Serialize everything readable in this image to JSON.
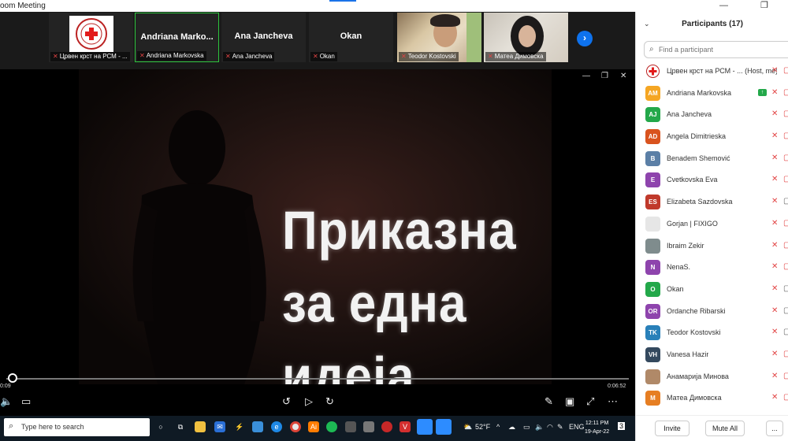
{
  "window": {
    "title": "oom Meeting",
    "restore_icon": "restore-icon"
  },
  "strip": {
    "tiles": [
      {
        "caption": "Црвен крст на РСМ - ...",
        "kind": "logo"
      },
      {
        "caption": "Andriana Markovska",
        "big_name": "Andriana Marko...",
        "active": true
      },
      {
        "caption": "Ana Jancheva",
        "big_name": "Ana Jancheva"
      },
      {
        "caption": "Okan",
        "big_name": "Okan"
      },
      {
        "caption": "Teodor Kostovski",
        "kind": "camera"
      },
      {
        "caption": "Матеа Димовска",
        "kind": "camera"
      }
    ],
    "next_icon": "chevron-right-icon"
  },
  "video": {
    "title_lines": [
      "Приказна",
      "за една",
      "идеја"
    ],
    "elapsed": "0:09",
    "duration": "0:06:52",
    "progress_fraction": 0.0022
  },
  "taskbar": {
    "search_placeholder": "Type here to search",
    "weather": "52°F",
    "language": "ENG",
    "time": "12:11 PM",
    "date": "19-Apr-22",
    "notification_count": "3"
  },
  "participants": {
    "title": "Participants (17)",
    "search_placeholder": "Find a participant",
    "list": [
      {
        "name": "Црвен крст на РСМ - ... (Host, me)",
        "initials": "",
        "color": "#ffffff",
        "cam": "red"
      },
      {
        "name": "Andriana Markovska",
        "initials": "AM",
        "color": "#f5a623",
        "cam": "red",
        "sharing": true
      },
      {
        "name": "Ana Jancheva",
        "initials": "AJ",
        "color": "#23a84a",
        "cam": "red"
      },
      {
        "name": "Angela Dimitrieska",
        "initials": "AD",
        "color": "#d9531e",
        "cam": "red"
      },
      {
        "name": "Benadem Shemović",
        "initials": "B",
        "color": "#5b7fa6",
        "cam": "red"
      },
      {
        "name": "Cvetkovska Eva",
        "initials": "E",
        "color": "#8e44ad",
        "cam": "red"
      },
      {
        "name": "Elizabeta Sazdovska",
        "initials": "ES",
        "color": "#c0392b",
        "cam": "grey"
      },
      {
        "name": "Gorjan | FIXIGO",
        "initials": "",
        "color": "#e6e6e6",
        "cam": "red"
      },
      {
        "name": "Ibraim Zekir",
        "initials": "",
        "color": "#7f8c8d",
        "cam": "red"
      },
      {
        "name": "NenaS.",
        "initials": "N",
        "color": "#8e44ad",
        "cam": "red"
      },
      {
        "name": "Okan",
        "initials": "O",
        "color": "#23a84a",
        "cam": "grey"
      },
      {
        "name": "Ordanche Ribarski",
        "initials": "OR",
        "color": "#8e44ad",
        "cam": "grey"
      },
      {
        "name": "Teodor Kostovski",
        "initials": "TK",
        "color": "#2980b9",
        "cam": "grey"
      },
      {
        "name": "Vanesa Hazir",
        "initials": "VH",
        "color": "#34495e",
        "cam": "red"
      },
      {
        "name": "Анамарија Минова",
        "initials": "",
        "color": "#b08968",
        "cam": "red"
      },
      {
        "name": "Матеа Димовска",
        "initials": "M",
        "color": "#e67e22",
        "cam": "red"
      }
    ],
    "invite_label": "Invite",
    "mute_all_label": "Mute All",
    "more_label": "..."
  }
}
